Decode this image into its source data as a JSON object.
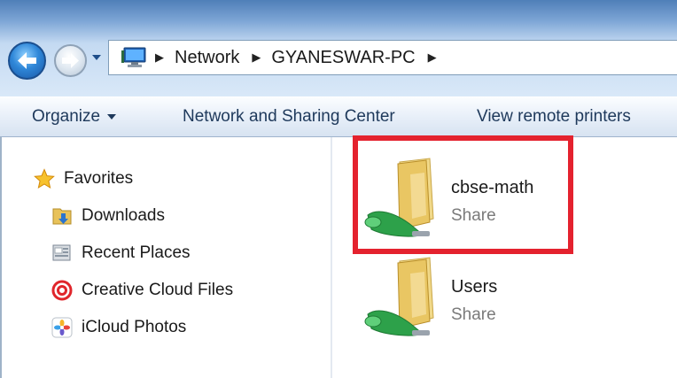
{
  "breadcrumb": {
    "items": [
      "Network",
      "GYANESWAR-PC"
    ]
  },
  "toolbar": {
    "organize": "Organize",
    "network_sharing": "Network and Sharing Center",
    "view_printers": "View remote printers"
  },
  "nav": {
    "favorites": "Favorites",
    "items": [
      {
        "label": "Downloads",
        "icon": "downloads-icon"
      },
      {
        "label": "Recent Places",
        "icon": "recent-places-icon"
      },
      {
        "label": "Creative Cloud Files",
        "icon": "creative-cloud-icon"
      },
      {
        "label": "iCloud Photos",
        "icon": "icloud-photos-icon"
      }
    ]
  },
  "shares": [
    {
      "name": "cbse-math",
      "type": "Share"
    },
    {
      "name": "Users",
      "type": "Share"
    }
  ],
  "colors": {
    "highlight": "#e4222e",
    "toolbar_text": "#1e395b",
    "secondary_text": "#7a7a7a"
  }
}
